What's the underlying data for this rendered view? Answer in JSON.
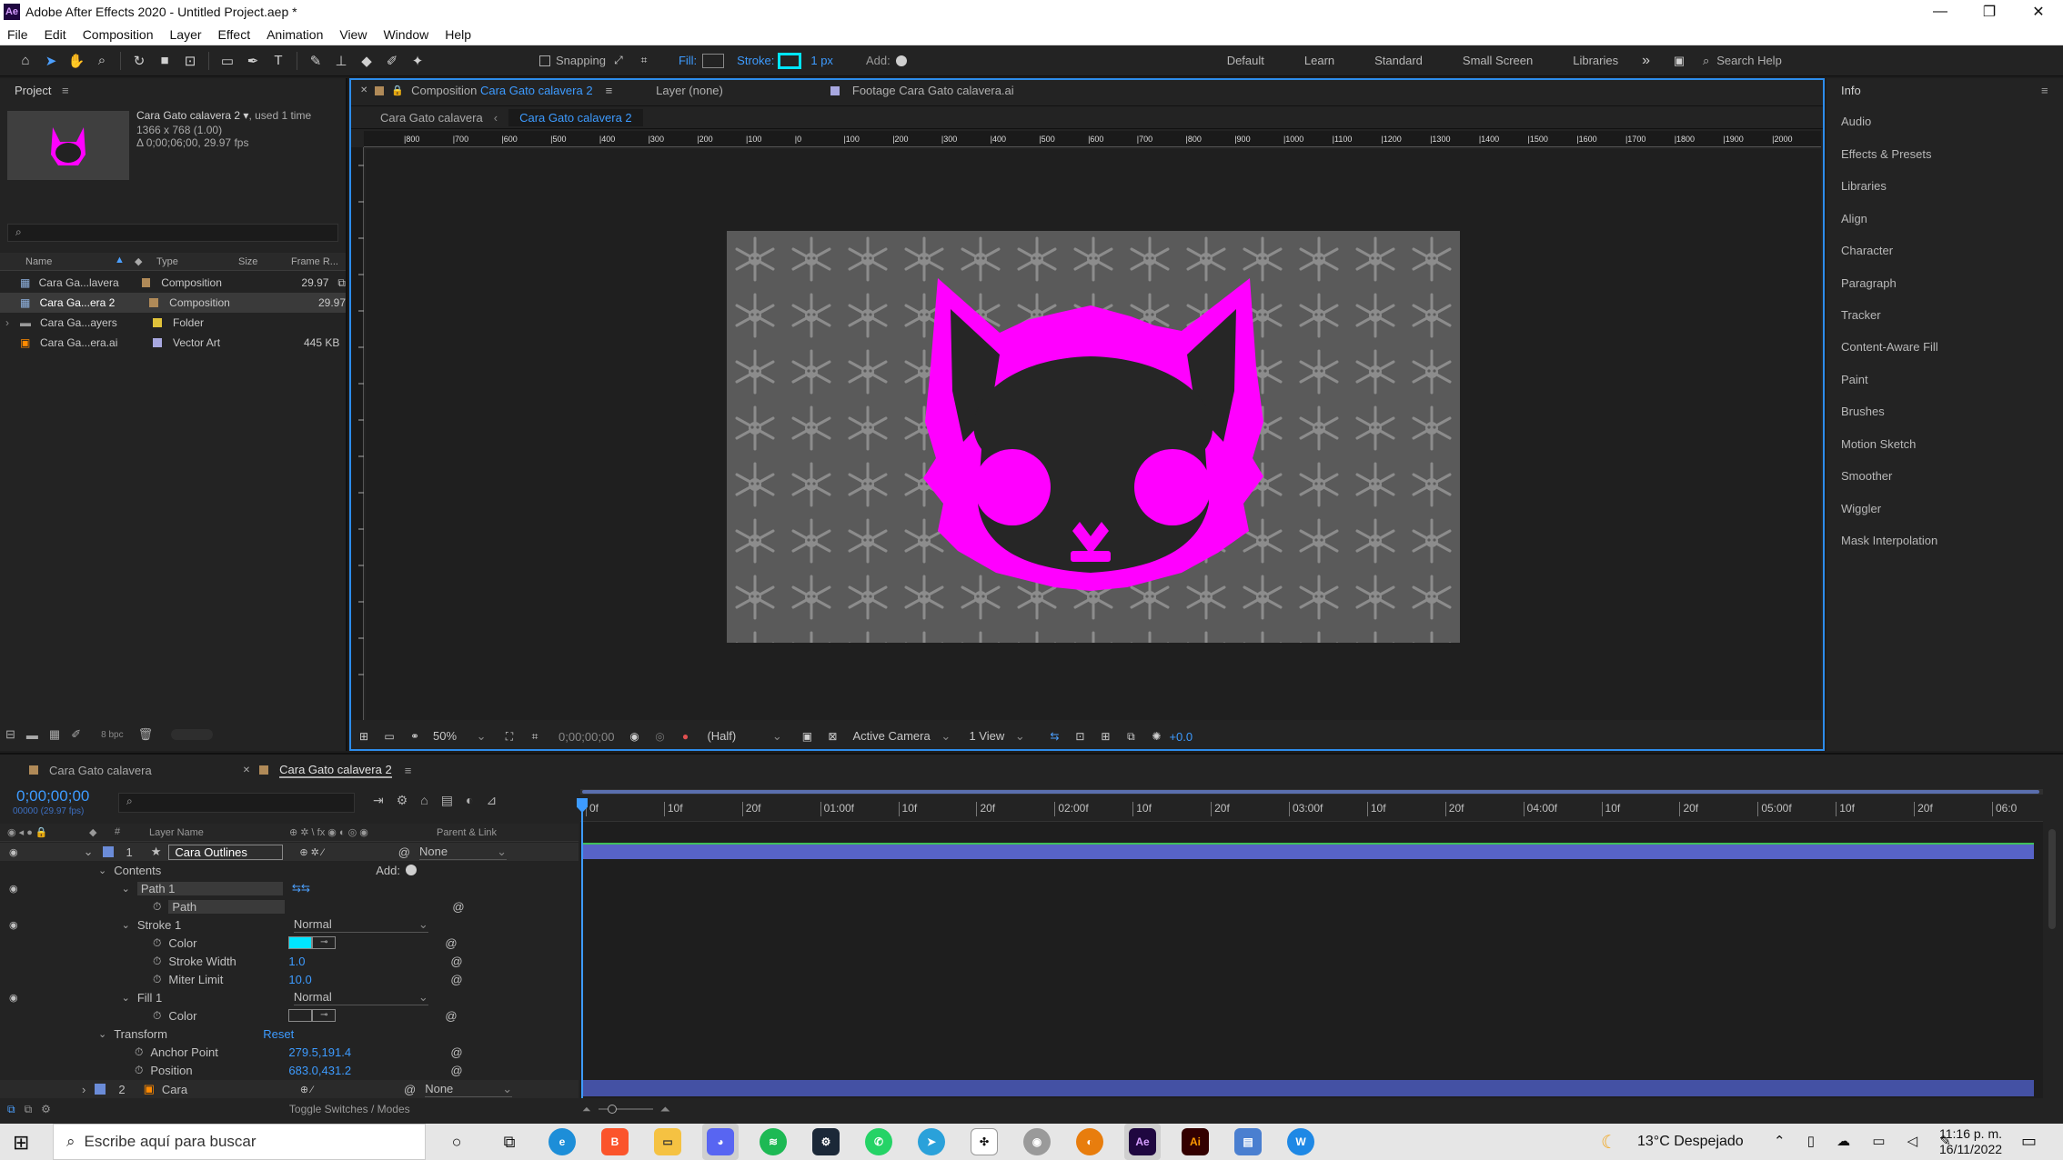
{
  "window": {
    "title": "Adobe After Effects 2020 - Untitled Project.aep *",
    "minimize": "—",
    "restore": "❐",
    "close": "✕"
  },
  "menu": [
    "File",
    "Edit",
    "Composition",
    "Layer",
    "Effect",
    "Animation",
    "View",
    "Window",
    "Help"
  ],
  "toolbar": {
    "snapping_label": "Snapping",
    "fill_label": "Fill:",
    "stroke_label": "Stroke:",
    "stroke_width": "1 px",
    "add_label": "Add:",
    "workspaces": [
      "Default",
      "Learn",
      "Standard",
      "Small Screen",
      "Libraries"
    ],
    "more": "»",
    "search_help": "Search Help",
    "stroke_color": "#00e5ff"
  },
  "project": {
    "title": "Project",
    "selected_name": "Cara Gato calavera 2",
    "used": ", used 1 time",
    "dimensions": "1366 x 768 (1.00)",
    "duration": "Δ 0;00;06;00, 29.97 fps",
    "search_placeholder": "",
    "columns": [
      "Name",
      "Type",
      "Size",
      "Frame R..."
    ],
    "rows": [
      {
        "name": "Cara Ga...lavera",
        "type": "Composition",
        "size": "",
        "fps": "29.97",
        "color": "#b08a58"
      },
      {
        "name": "Cara Ga...era 2",
        "type": "Composition",
        "size": "",
        "fps": "29.97",
        "color": "#b08a58"
      },
      {
        "name": "Cara Ga...ayers",
        "type": "Folder",
        "size": "",
        "fps": "",
        "color": "#e0c23a"
      },
      {
        "name": "Cara Ga...era.ai",
        "type": "Vector Art",
        "size": "445 KB",
        "fps": "",
        "color": "#a8a8e0"
      }
    ],
    "bpc": "8 bpc"
  },
  "viewer": {
    "comp_tab_prefix": "Composition",
    "comp_tab_name": "Cara Gato calavera 2",
    "layer_tab": "Layer  (none)",
    "footage_tab_prefix": "Footage",
    "footage_tab_name": "Cara Gato calavera.ai",
    "breadcrumb": [
      "Cara Gato calavera",
      "Cara Gato calavera 2"
    ],
    "ruler_ticks": [
      "|800",
      "|700",
      "|600",
      "|500",
      "|400",
      "|300",
      "|200",
      "|100",
      "|0",
      "|100",
      "|200",
      "|300",
      "|400",
      "|500",
      "|600",
      "|700",
      "|800",
      "|900",
      "|1000",
      "|1100",
      "|1200",
      "|1300",
      "|1400",
      "|1500",
      "|1600",
      "|1700",
      "|1800",
      "|1900",
      "|2000"
    ],
    "zoom": "50%",
    "timecode": "0;00;00;00",
    "resolution": "(Half)",
    "camera": "Active Camera",
    "views": "1 View",
    "exposure": "+0.0",
    "cat_color": "#ff00ff",
    "bg_color": "#5a5a5a"
  },
  "right_panels": [
    "Info",
    "Audio",
    "Effects & Presets",
    "Libraries",
    "Align",
    "Character",
    "Paragraph",
    "Tracker",
    "Content-Aware Fill",
    "Paint",
    "Brushes",
    "Motion Sketch",
    "Smoother",
    "Wiggler",
    "Mask Interpolation"
  ],
  "timeline": {
    "tabs": [
      "Cara Gato calavera",
      "Cara Gato calavera 2"
    ],
    "timecode": "0;00;00;00",
    "fps_sub": "00000 (29.97 fps)",
    "col_layer_name": "Layer Name",
    "col_parent": "Parent & Link",
    "ruler": [
      "0f",
      "10f",
      "20f",
      "01:00f",
      "10f",
      "20f",
      "02:00f",
      "10f",
      "20f",
      "03:00f",
      "10f",
      "20f",
      "04:00f",
      "10f",
      "20f",
      "05:00f",
      "10f",
      "20f",
      "06:0"
    ],
    "layer1_num": "1",
    "layer1_name": "Cara Outlines",
    "layer1_parent": "None",
    "contents": "Contents",
    "add": "Add:",
    "path1": "Path 1",
    "path": "Path",
    "stroke1": "Stroke 1",
    "stroke_mode": "Normal",
    "color": "Color",
    "stroke_width_label": "Stroke Width",
    "stroke_width_val": "1.0",
    "miter_label": "Miter Limit",
    "miter_val": "10.0",
    "fill1": "Fill 1",
    "fill_mode": "Normal",
    "fill_color_label": "Color",
    "transform": "Transform",
    "reset": "Reset",
    "anchor_label": "Anchor Point",
    "anchor_val": "279.5,191.4",
    "position_label": "Position",
    "position_val": "683.0,431.2",
    "layer2_num": "2",
    "layer2_name": "Cara",
    "layer2_parent": "None",
    "toggle": "Toggle Switches / Modes"
  },
  "taskbar": {
    "search_placeholder": "Escribe aquí para buscar",
    "weather": "13°C  Despejado",
    "time": "11:16 p. m.",
    "date": "16/11/2022"
  }
}
